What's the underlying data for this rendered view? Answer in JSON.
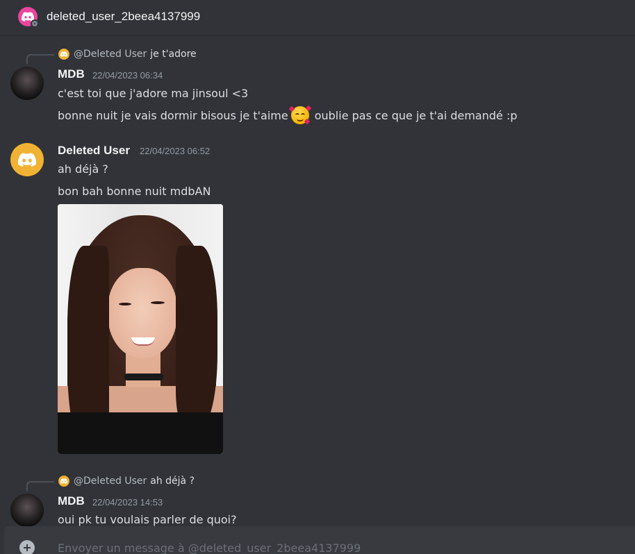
{
  "header": {
    "title": "deleted_user_2beea4137999",
    "avatar_icon": "discord-logo-icon",
    "status": "offline"
  },
  "messages": [
    {
      "reply": {
        "author": "@Deleted User",
        "text": "je t'adore"
      },
      "author": "MDB",
      "timestamp": "22/04/2023 06:34",
      "lines": [
        "c'est toi que j'adore ma jinsoul <3",
        {
          "before": "bonne nuit je vais dormir bisous je t'aime",
          "emoji": "smiling-face-with-hearts",
          "after": "oublie pas ce que je t'ai demandé :p"
        }
      ]
    },
    {
      "author": "Deleted User",
      "timestamp": "22/04/2023 06:52",
      "lines": [
        "ah déjà ?",
        "bon bah bonne nuit mdbAN"
      ],
      "attachment": "gif-image"
    },
    {
      "reply": {
        "author": "@Deleted User",
        "text": "ah déjà ?"
      },
      "author": "MDB",
      "timestamp": "22/04/2023 14:53",
      "lines": [
        "oui pk tu voulais parler de quoi?"
      ]
    }
  ],
  "composer": {
    "placeholder": "Envoyer un message à @deleted_user_2beea4137999"
  },
  "colors": {
    "background": "#313338",
    "deleted_user_avatar": "#f0b232",
    "header_avatar": "#eb459f"
  }
}
